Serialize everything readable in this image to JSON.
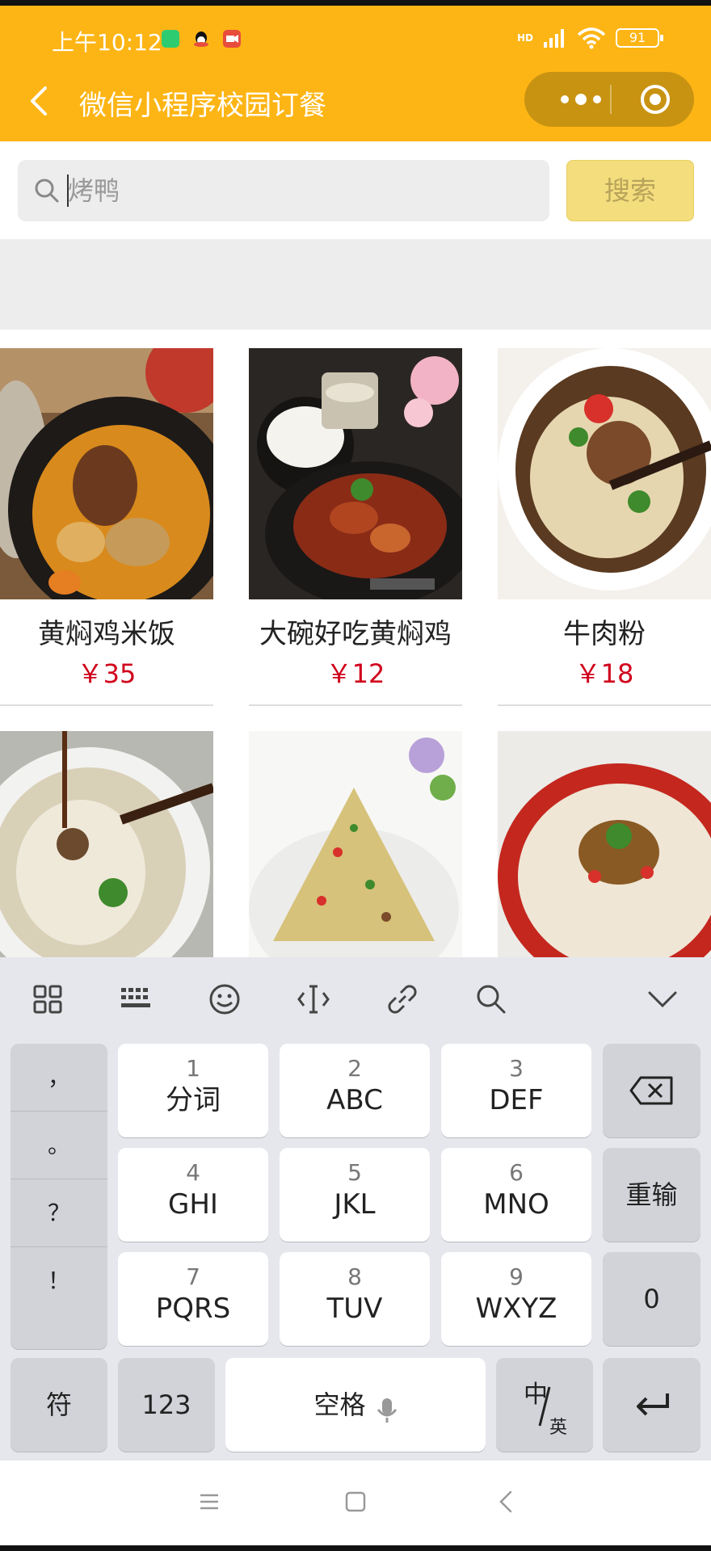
{
  "status": {
    "time": "上午10:12",
    "battery": "91",
    "hd": "HD"
  },
  "nav": {
    "title": "微信小程序校园订餐"
  },
  "search": {
    "placeholder": "烤鸭",
    "button_label": "搜索"
  },
  "foods": [
    {
      "name": "黄焖鸡米饭",
      "price": "￥35"
    },
    {
      "name": "大碗好吃黄焖鸡",
      "price": "￥12"
    },
    {
      "name": "牛肉粉",
      "price": "￥18"
    },
    {
      "name": "",
      "price": ""
    },
    {
      "name": "",
      "price": ""
    },
    {
      "name": "",
      "price": ""
    }
  ],
  "keyboard": {
    "toolbar_icons": [
      "grid-icon",
      "keyboard-icon",
      "emoji-icon",
      "cursor-icon",
      "link-icon",
      "search-icon",
      "chevron-down-icon"
    ],
    "punctuation": [
      "，",
      "。",
      "？",
      "！"
    ],
    "keys": [
      {
        "num": "1",
        "letters": "分词"
      },
      {
        "num": "2",
        "letters": "ABC"
      },
      {
        "num": "3",
        "letters": "DEF"
      },
      {
        "num": "4",
        "letters": "GHI"
      },
      {
        "num": "5",
        "letters": "JKL"
      },
      {
        "num": "6",
        "letters": "MNO"
      },
      {
        "num": "7",
        "letters": "PQRS"
      },
      {
        "num": "8",
        "letters": "TUV"
      },
      {
        "num": "9",
        "letters": "WXYZ"
      }
    ],
    "reinput": "重输",
    "zero": "0",
    "symbols": "符",
    "numbers": "123",
    "space": "空格",
    "lang_zh": "中",
    "lang_en": "英"
  },
  "colors": {
    "header": "#FDB515",
    "price": "#D0021B",
    "search_button": "#F3DD7D"
  }
}
